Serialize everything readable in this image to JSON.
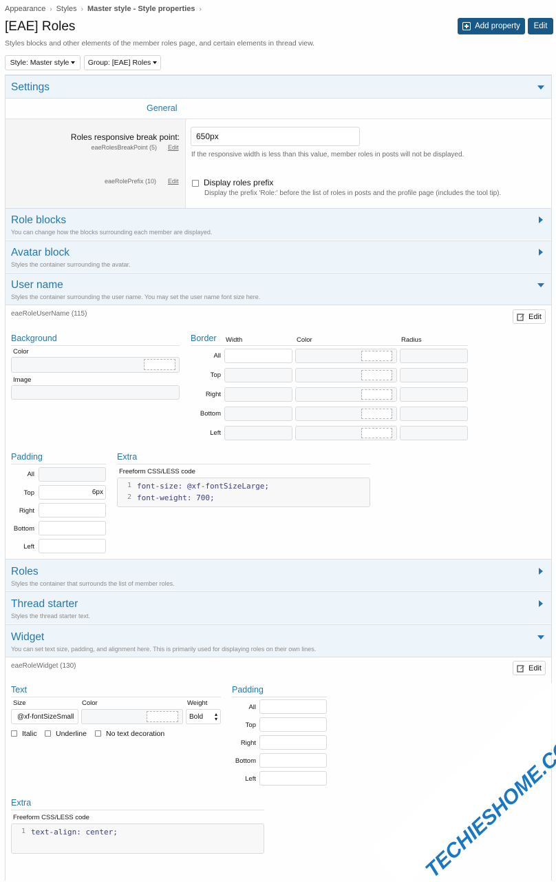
{
  "breadcrumb": [
    "Appearance",
    "Styles",
    "Master style - Style properties"
  ],
  "page": {
    "title": "[EAE] Roles",
    "description": "Styles blocks and other elements of the member roles page, and certain elements in thread view."
  },
  "actions": {
    "add_property": "Add property",
    "edit": "Edit"
  },
  "filters": {
    "style": "Style: Master style",
    "group": "Group: [EAE] Roles"
  },
  "sections": {
    "settings": {
      "title": "Settings",
      "group_label": "General",
      "breakpoint": {
        "label": "Roles responsive break point:",
        "meta": "eaeRolesBreakPoint (5)",
        "edit": "Edit",
        "value": "650px",
        "hint": "If the responsive width is less than this value, member roles in posts will not be displayed."
      },
      "prefix": {
        "meta": "eaeRolePrefix (10)",
        "edit": "Edit",
        "label": "Display roles prefix",
        "hint": "Display the prefix 'Role:' before the list of roles in posts and the profile page (includes the tool tip)."
      }
    },
    "role_blocks": {
      "title": "Role blocks",
      "desc": "You can change how the blocks surrounding each member are displayed."
    },
    "avatar_block": {
      "title": "Avatar block",
      "desc": "Styles the container surrounding the avatar."
    },
    "user_name": {
      "title": "User name",
      "desc": "Styles the container surrounding the user name. You may set the user name font size here.",
      "meta": "eaeRoleUserName (115)",
      "edit": "Edit",
      "background": {
        "title": "Background",
        "color_label": "Color",
        "image_label": "Image"
      },
      "border": {
        "title": "Border",
        "col_width": "Width",
        "col_color": "Color",
        "col_radius": "Radius",
        "rows": [
          "All",
          "Top",
          "Right",
          "Bottom",
          "Left"
        ]
      },
      "padding": {
        "title": "Padding",
        "rows": [
          "All",
          "Top",
          "Right",
          "Bottom",
          "Left"
        ],
        "top_value": "6px"
      },
      "extra": {
        "title": "Extra",
        "label": "Freeform CSS/LESS code",
        "lines": [
          "font-size: @xf-fontSizeLarge;",
          "font-weight: 700;"
        ],
        "line_numbers": [
          "1",
          "2"
        ]
      }
    },
    "roles": {
      "title": "Roles",
      "desc": "Styles the container that surrounds the list of member roles."
    },
    "thread_starter": {
      "title": "Thread starter",
      "desc": "Styles the thread starter text."
    },
    "widget": {
      "title": "Widget",
      "desc": "You can set text size, padding, and alignment here. This is primarily used for displaying roles on their own lines.",
      "meta": "eaeRoleWidget (130)",
      "edit": "Edit",
      "text": {
        "title": "Text",
        "size_label": "Size",
        "color_label": "Color",
        "weight_label": "Weight",
        "size_value": "@xf-fontSizeSmall",
        "weight_value": "Bold",
        "italic": "Italic",
        "underline": "Underline",
        "no_decoration": "No text decoration"
      },
      "padding": {
        "title": "Padding",
        "rows": [
          "All",
          "Top",
          "Right",
          "Bottom",
          "Left"
        ]
      },
      "extra": {
        "title": "Extra",
        "label": "Freeform CSS/LESS code",
        "lines": [
          "text-align: center;"
        ],
        "line_numbers": [
          "1"
        ]
      }
    }
  },
  "watermark": "TECHIESHOME.COM",
  "colors": {
    "accent": "#2577b1",
    "primary_button": "#185886",
    "section_header_bg": "#edf4fa"
  }
}
